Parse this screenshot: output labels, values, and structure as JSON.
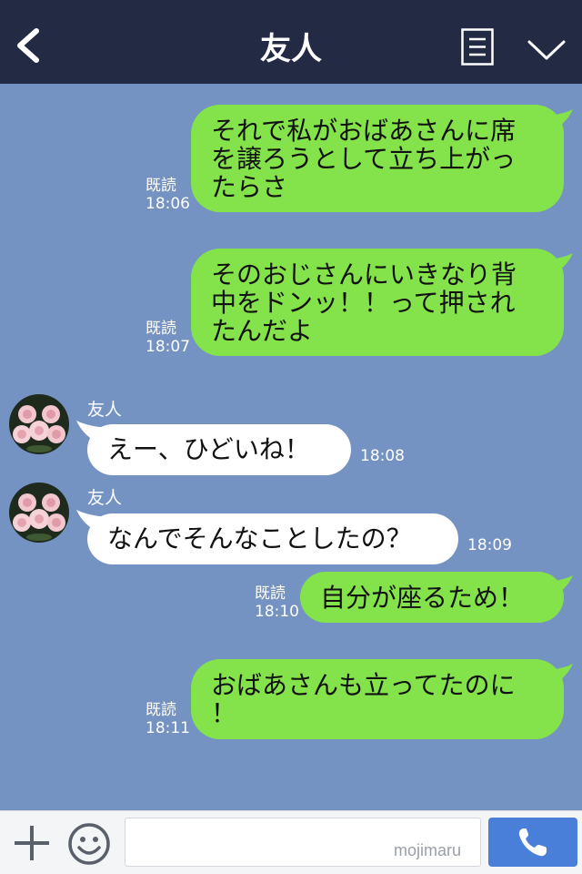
{
  "header": {
    "title": "友人",
    "back_icon": "chevron-left-icon",
    "menu_icon": "notes-icon",
    "collapse_icon": "chevron-down-icon",
    "background": "#232b44"
  },
  "chat": {
    "background": "#7492c2",
    "mine_bubble_color": "#84e24b",
    "their_bubble_color": "#ffffff",
    "messages": [
      {
        "from": "me",
        "lines": [
          "それで私がおばあさんに席",
          "を譲ろうとして立ち上がっ",
          "たらさ"
        ],
        "read": "既読",
        "time": "18:06"
      },
      {
        "from": "me",
        "lines": [
          "そのおじさんにいきなり背",
          "中をドンッ！！って押され",
          "たんだよ"
        ],
        "read": "既読",
        "time": "18:07"
      },
      {
        "from": "friend",
        "sender": "友人",
        "lines": [
          "えー、ひどいね！"
        ],
        "time": "18:08"
      },
      {
        "from": "friend",
        "sender": "友人",
        "lines": [
          "なんでそんなことしたの？"
        ],
        "time": "18:09"
      },
      {
        "from": "me",
        "lines": [
          "自分が座るため！"
        ],
        "read": "既読",
        "time": "18:10"
      },
      {
        "from": "me",
        "lines": [
          "おばあさんも立ってたのに",
          "！"
        ],
        "read": "既読",
        "time": "18:11"
      }
    ]
  },
  "input_bar": {
    "add_icon": "plus-icon",
    "emoji_icon": "smile-icon",
    "message_value": "",
    "watermark": "mojimaru",
    "call_icon": "phone-icon",
    "call_button_color": "#4a7fd9"
  }
}
